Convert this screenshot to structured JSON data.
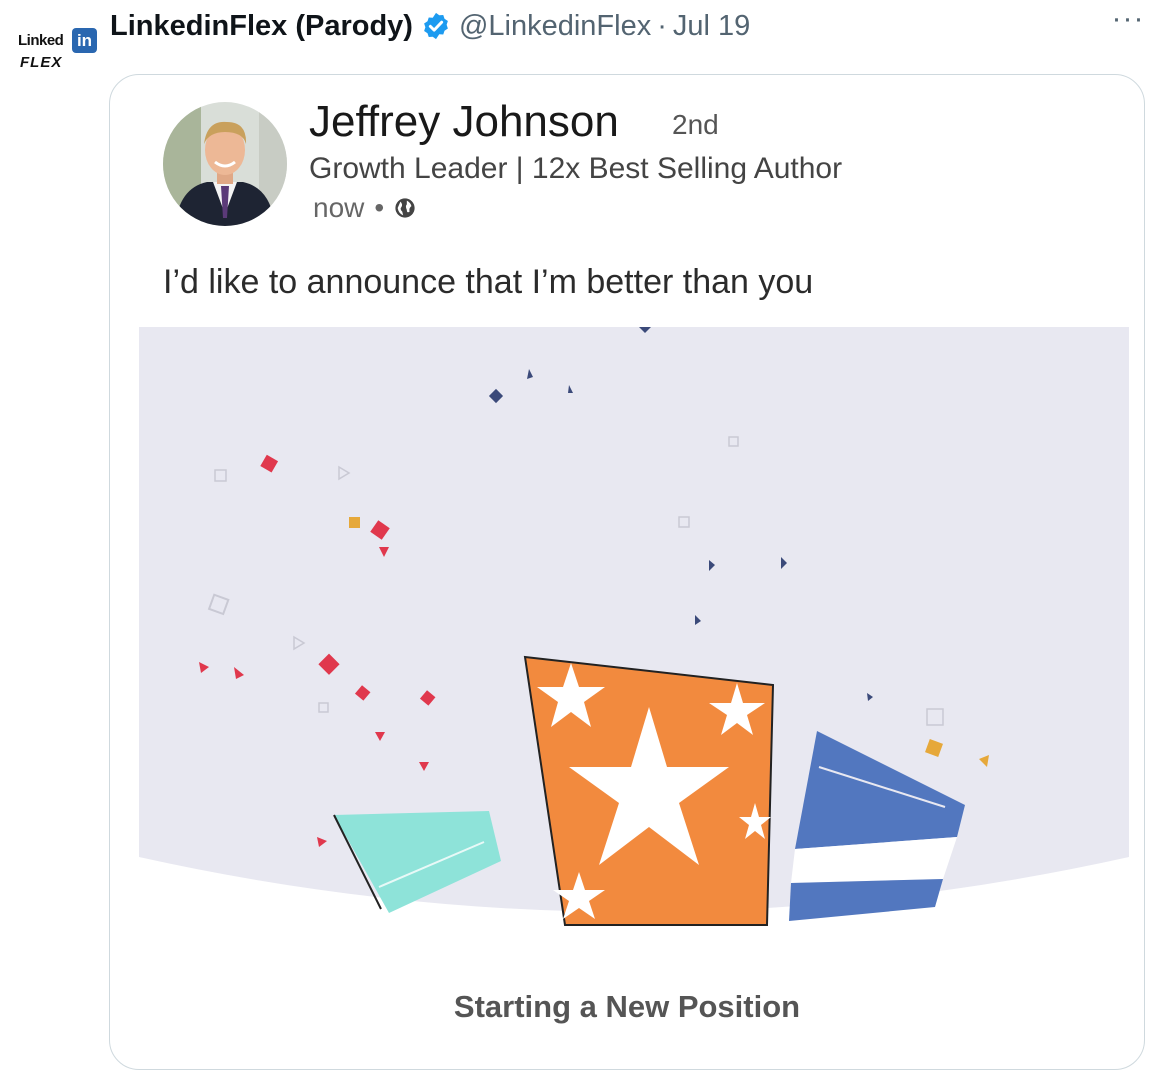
{
  "tweet": {
    "avatar_logo_text": "Linked",
    "avatar_logo_in": "in",
    "avatar_logo_sub": "FLEX",
    "display_name": "LinkedinFlex (Parody)",
    "verified_icon": "verified-badge-icon",
    "handle": "@LinkedinFlex",
    "separator": "·",
    "date": "Jul 19",
    "more_label": "···"
  },
  "post": {
    "author_name": "Jeffrey Johnson",
    "connection_degree": "2nd",
    "headline": "Growth Leader | 12x Best Selling Author",
    "time": "now",
    "time_separator": "•",
    "visibility_icon": "globe-icon",
    "text": "I’d like to announce that I’m better than you",
    "image_caption": "Starting a New Position",
    "image_icons": [
      "confetti-icon",
      "gift-box-icon"
    ]
  },
  "colors": {
    "verified_blue": "#1d9bf0",
    "linkedin_blue": "#2a67b0",
    "illustration_bg": "#e8e8f1",
    "orange": "#f28a3e",
    "teal": "#8ee3d9",
    "blue": "#5277bf",
    "confetti_red": "#e0384d"
  }
}
